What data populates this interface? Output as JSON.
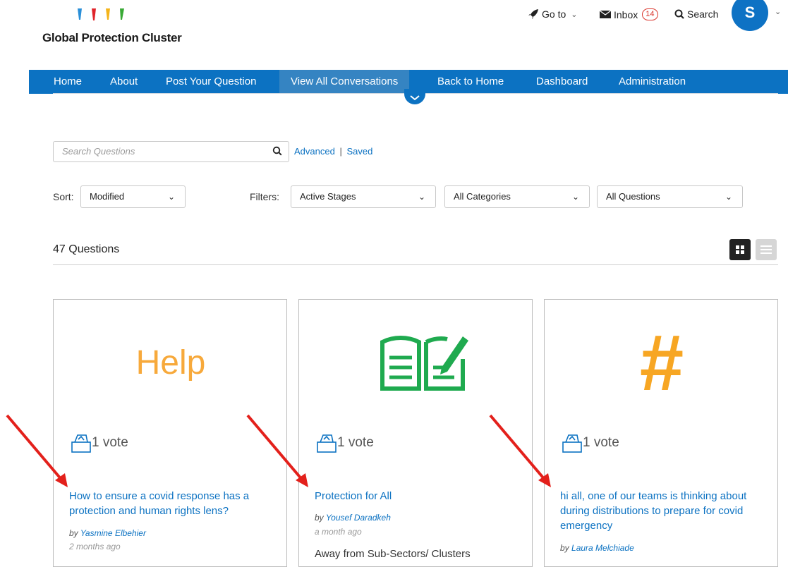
{
  "header": {
    "logo_text": "Global Protection Cluster",
    "logo_drop_colors": [
      "#2a8fd8",
      "#e0242a",
      "#f4b41a",
      "#39a935"
    ],
    "goto_label": "Go to",
    "inbox_label": "Inbox",
    "inbox_count": "14",
    "search_label": "Search",
    "avatar_initial": "S"
  },
  "nav": {
    "items": [
      {
        "label": "Home"
      },
      {
        "label": "About"
      },
      {
        "label": "Post Your Question"
      },
      {
        "label": "View All Conversations",
        "active": true
      },
      {
        "label": "Back to Home"
      },
      {
        "label": "Dashboard"
      },
      {
        "label": "Administration"
      }
    ]
  },
  "search": {
    "placeholder": "Search Questions",
    "advanced_label": "Advanced",
    "separator": "|",
    "saved_label": "Saved"
  },
  "sort": {
    "label": "Sort:",
    "value": "Modified"
  },
  "filters": {
    "label": "Filters:",
    "stage": "Active Stages",
    "category": "All Categories",
    "questions": "All Questions"
  },
  "results": {
    "count_label": "47 Questions"
  },
  "cards": [
    {
      "image_text": "Help",
      "votes": "1 vote",
      "title": "How to ensure a covid response has a protection and human rights lens?",
      "by_prefix": "by",
      "author": "Yasmine Elbehier",
      "when": "2 months ago",
      "snippet": ""
    },
    {
      "image_icon": "open-book-with-pencil-icon",
      "votes": "1 vote",
      "title": "Protection for All",
      "by_prefix": "by",
      "author": "Yousef Daradkeh",
      "when": "a month ago",
      "snippet": "Away from Sub-Sectors/ Clusters"
    },
    {
      "image_text": "#",
      "votes": "1 vote",
      "title": "hi all, one of our teams is thinking about during distributions to prepare for covid emergency",
      "by_prefix": "by",
      "author": "Laura Melchiade",
      "when": "",
      "snippet": ""
    }
  ],
  "colors": {
    "brand_blue": "#0c72c2",
    "help_orange": "#f7a93b",
    "hash_orange": "#f7a623",
    "book_green": "#1faa4f",
    "annotation_red": "#e3201b"
  }
}
